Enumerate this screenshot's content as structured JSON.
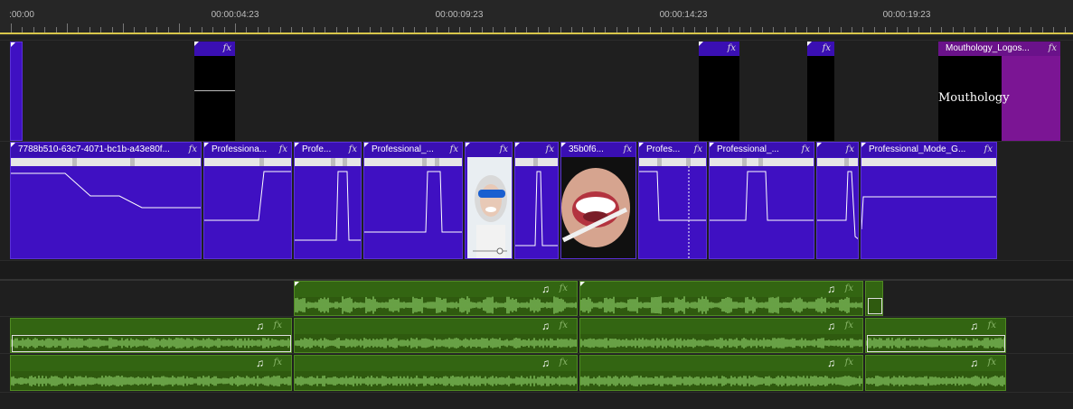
{
  "ruler": {
    "labels": [
      ":00:00",
      "00:00:04:23",
      "00:00:09:23",
      "00:00:14:23",
      "00:00:19:23"
    ]
  },
  "colors": {
    "video_clip": "#3f10c2",
    "logo_clip": "#5a0fa0",
    "logo_side": "#7b1594",
    "audio_clip": "#2f5a0f",
    "waveform": "#8fd06a",
    "playhead_line": "#d8c64a"
  },
  "tracks": {
    "v2": {
      "clips": [
        {
          "label": "",
          "fx": ""
        },
        {
          "label": "",
          "fx": "fx"
        },
        {
          "label": "",
          "fx": "fx"
        },
        {
          "label": "",
          "fx": "fx"
        },
        {
          "label": "Mouthology_Logos...",
          "fx": "fx",
          "thumb_text": "Mouthology"
        }
      ]
    },
    "v1": {
      "clips": [
        {
          "label": "7788b510-63c7-4071-bc1b-a43e80f...",
          "fx": "fx"
        },
        {
          "label": "Professiona...",
          "fx": "fx"
        },
        {
          "label": "Profe...",
          "fx": "fx"
        },
        {
          "label": "Professional_...",
          "fx": "fx"
        },
        {
          "label": "",
          "fx": "fx",
          "thumb": "woman-goggles-thumbnail"
        },
        {
          "label": "",
          "fx": "fx"
        },
        {
          "label": "35b0f6...",
          "fx": "fx",
          "thumb": "smile-toothbrush-thumbnail"
        },
        {
          "label": "Profes...",
          "fx": "fx"
        },
        {
          "label": "Professional_...",
          "fx": "fx"
        },
        {
          "label": "",
          "fx": "fx"
        },
        {
          "label": "Professional_Mode_G...",
          "fx": "fx"
        }
      ]
    },
    "a1": {
      "clips": [
        {
          "note": "♫",
          "fx": "fx"
        },
        {
          "note": "♫",
          "fx": "fx"
        },
        {
          "note": "",
          "fx": ""
        }
      ]
    },
    "a2": {
      "clips": [
        {
          "note": "♫",
          "fx": "fx"
        },
        {
          "note": "♫",
          "fx": "fx"
        },
        {
          "note": "♫",
          "fx": "fx"
        },
        {
          "note": "♫",
          "fx": "fx"
        }
      ]
    },
    "a3": {
      "clips": [
        {
          "note": "♫",
          "fx": "fx"
        },
        {
          "note": "♫",
          "fx": "fx"
        },
        {
          "note": "♫",
          "fx": "fx"
        },
        {
          "note": "♫",
          "fx": "fx"
        }
      ]
    }
  }
}
